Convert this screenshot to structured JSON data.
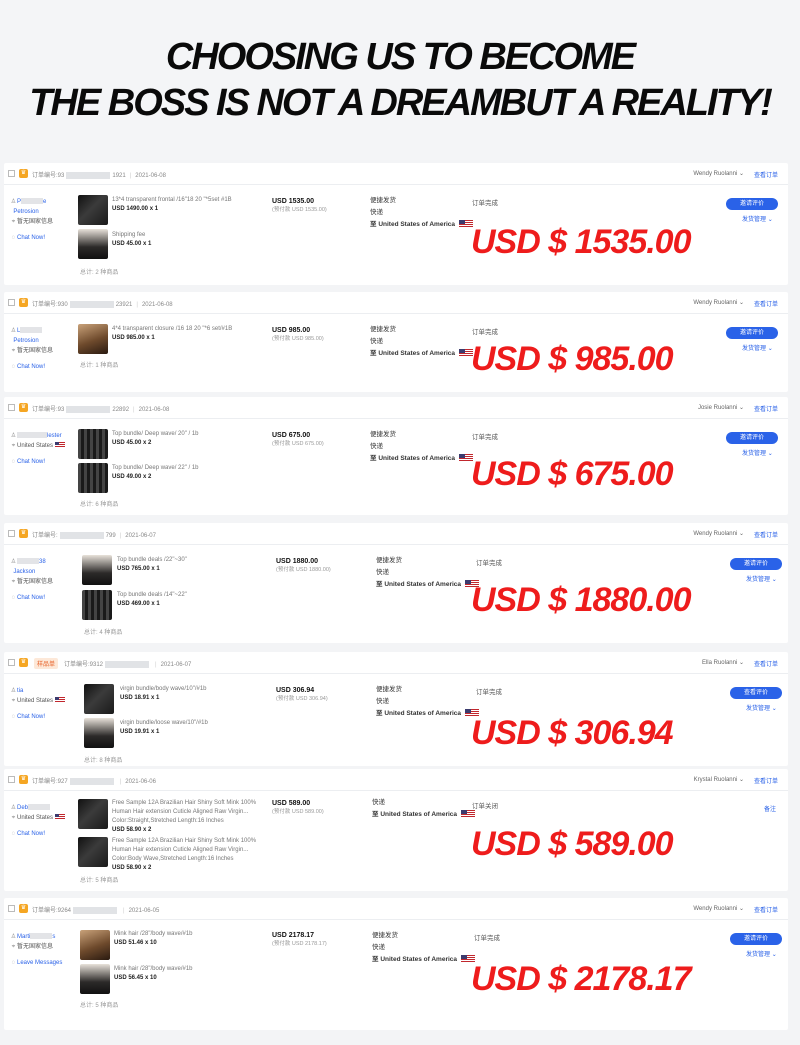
{
  "headline": {
    "line1": "CHOOSING US TO BECOME",
    "line2": "THE BOSS IS NOT A DREAMBUT A REALITY!"
  },
  "colors": {
    "accent_blue": "#2a62e8",
    "big_price_red": "#ee1c1c",
    "crown_gold": "#f5a623"
  },
  "common": {
    "order_label": "订单编号:",
    "view_order": "查看订单",
    "chat_now": "Chat Now!",
    "leave_messages": "Leave Messages",
    "no_country": "暂无国家信息",
    "united_states": "United States",
    "ship_method": "便捷发货",
    "express": "快递",
    "to": "至",
    "dest": "United States of America",
    "review_btn": "邀请评价",
    "view_review_btn": "查看评价",
    "ship_manage": "发货管理",
    "completed": "订单完成",
    "closed": "订单关闭",
    "remark": "备注",
    "chevron": "⌄"
  },
  "orders": [
    {
      "order_prefix": "93",
      "order_suffix": "1921",
      "date": "2021-06-08",
      "seller": "Wendy Ruolanni",
      "buyer_name": "Petrosion",
      "buyer_prefix": "P",
      "buyer_suffix": "e",
      "items": [
        {
          "desc": "13*4 transparent frontal /16\"18 20 \"*5set #1B",
          "price": "USD 1490.00 x 1"
        },
        {
          "desc": "Shipping fee",
          "price": "USD 45.00 x 1"
        }
      ],
      "total": "总计: 2 种商品",
      "amount": "USD 1535.00",
      "amount_sub": "(预付款 USD 1535.00)",
      "status": "订单完成",
      "big_price": "USD $ 1535.00"
    },
    {
      "order_prefix": "930",
      "order_suffix": "23921",
      "date": "2021-06-08",
      "seller": "Wendy Ruolanni",
      "buyer_name": "Petrosion",
      "buyer_prefix": "L",
      "items": [
        {
          "desc": "4*4 transparent closure /16 18 20 \"*6 set/#1B",
          "price": "USD 985.00 x 1"
        }
      ],
      "total": "总计: 1 种商品",
      "amount": "USD 985.00",
      "amount_sub": "(预付款 USD 985.00)",
      "status": "订单完成",
      "big_price": "USD $ 985.00"
    },
    {
      "order_prefix": "93",
      "order_suffix": "22892",
      "date": "2021-06-08",
      "seller": "Josie Ruolanni",
      "buyer_name": "lester",
      "items": [
        {
          "desc": "Top bundle/ Deep wave/ 20\" / 1b",
          "price": "USD 45.00 x 2"
        },
        {
          "desc": "Top bundle/ Deep wave/ 22\" / 1b",
          "price": "USD 49.00 x 2"
        }
      ],
      "total": "总计: 6 种商品",
      "amount": "USD 675.00",
      "amount_sub": "(预付款 USD 675.00)",
      "status": "订单完成",
      "big_price": "USD $ 675.00"
    },
    {
      "order_prefix": "",
      "order_suffix": "799",
      "date": "2021-06-07",
      "seller": "Wendy Ruolanni",
      "buyer_name": "Jackson",
      "buyer_prefix": "",
      "buyer_suffix": "38",
      "items": [
        {
          "desc": "Top bundle deals /22\"~30\"",
          "price": "USD 765.00 x 1"
        },
        {
          "desc": "Top bundle deals /14\"~22\"",
          "price": "USD 469.00 x 1"
        }
      ],
      "total": "总计: 4 种商品",
      "amount": "USD 1880.00",
      "amount_sub": "(预付款 USD 1880.00)",
      "status": "订单完成",
      "big_price": "USD $ 1880.00"
    },
    {
      "badge": "样品单",
      "order_prefix": "9312",
      "order_suffix": "",
      "date": "2021-06-07",
      "seller": "Ella Ruolanni",
      "buyer_name": "tia",
      "items": [
        {
          "desc": "virgin bundle/body wave/10\"/#1b",
          "price": "USD 18.91 x 1"
        },
        {
          "desc": "virgin bundle/loose wave/10\"/#1b",
          "price": "USD 19.91 x 1"
        }
      ],
      "total": "总计: 8 种商品",
      "amount": "USD 306.94",
      "amount_sub": "(预付款 USD 306.94)",
      "status": "订单完成",
      "big_price": "USD $ 306.94"
    },
    {
      "order_prefix": "927",
      "order_suffix": "",
      "date": "2021-06-06",
      "seller": "Krystal Ruolanni",
      "buyer_name": "Debo",
      "buyer_prefix": "Deb",
      "items": [
        {
          "desc": "Free Sample 12A Brazilian Hair Shiny Soft Mink 100% Human Hair extension Cuticle Aligned Raw Virgin... Color:Straight,Stretched Length:16 Inches",
          "price": "USD 58.90 x 2"
        },
        {
          "desc": "Free Sample 12A Brazilian Hair Shiny Soft Mink 100% Human Hair extension Cuticle Aligned Raw Virgin... Color:Body Wave,Stretched Length:16 Inches",
          "price": "USD 58.90 x 2"
        }
      ],
      "total": "总计: 5 种商品",
      "amount": "USD 589.00",
      "amount_sub": "(预付款 USD 589.00)",
      "status": "订单关闭",
      "big_price": "USD $ 589.00"
    },
    {
      "order_prefix": "9264",
      "order_suffix": "",
      "date": "2021-06-05",
      "seller": "Wendy Ruolanni",
      "buyer_name": "Marti",
      "buyer_suffix": "s",
      "items": [
        {
          "desc": "Mink hair /28\"/body wave/#1b",
          "price": "USD 51.46 x 10"
        },
        {
          "desc": "Mink hair /28\"/body wave/#1b",
          "price": "USD 56.45 x 10"
        }
      ],
      "total": "总计: 5 种商品",
      "amount": "USD 2178.17",
      "amount_sub": "(预付款 USD 2178.17)",
      "status": "订单完成",
      "big_price": "USD $ 2178.17"
    }
  ]
}
